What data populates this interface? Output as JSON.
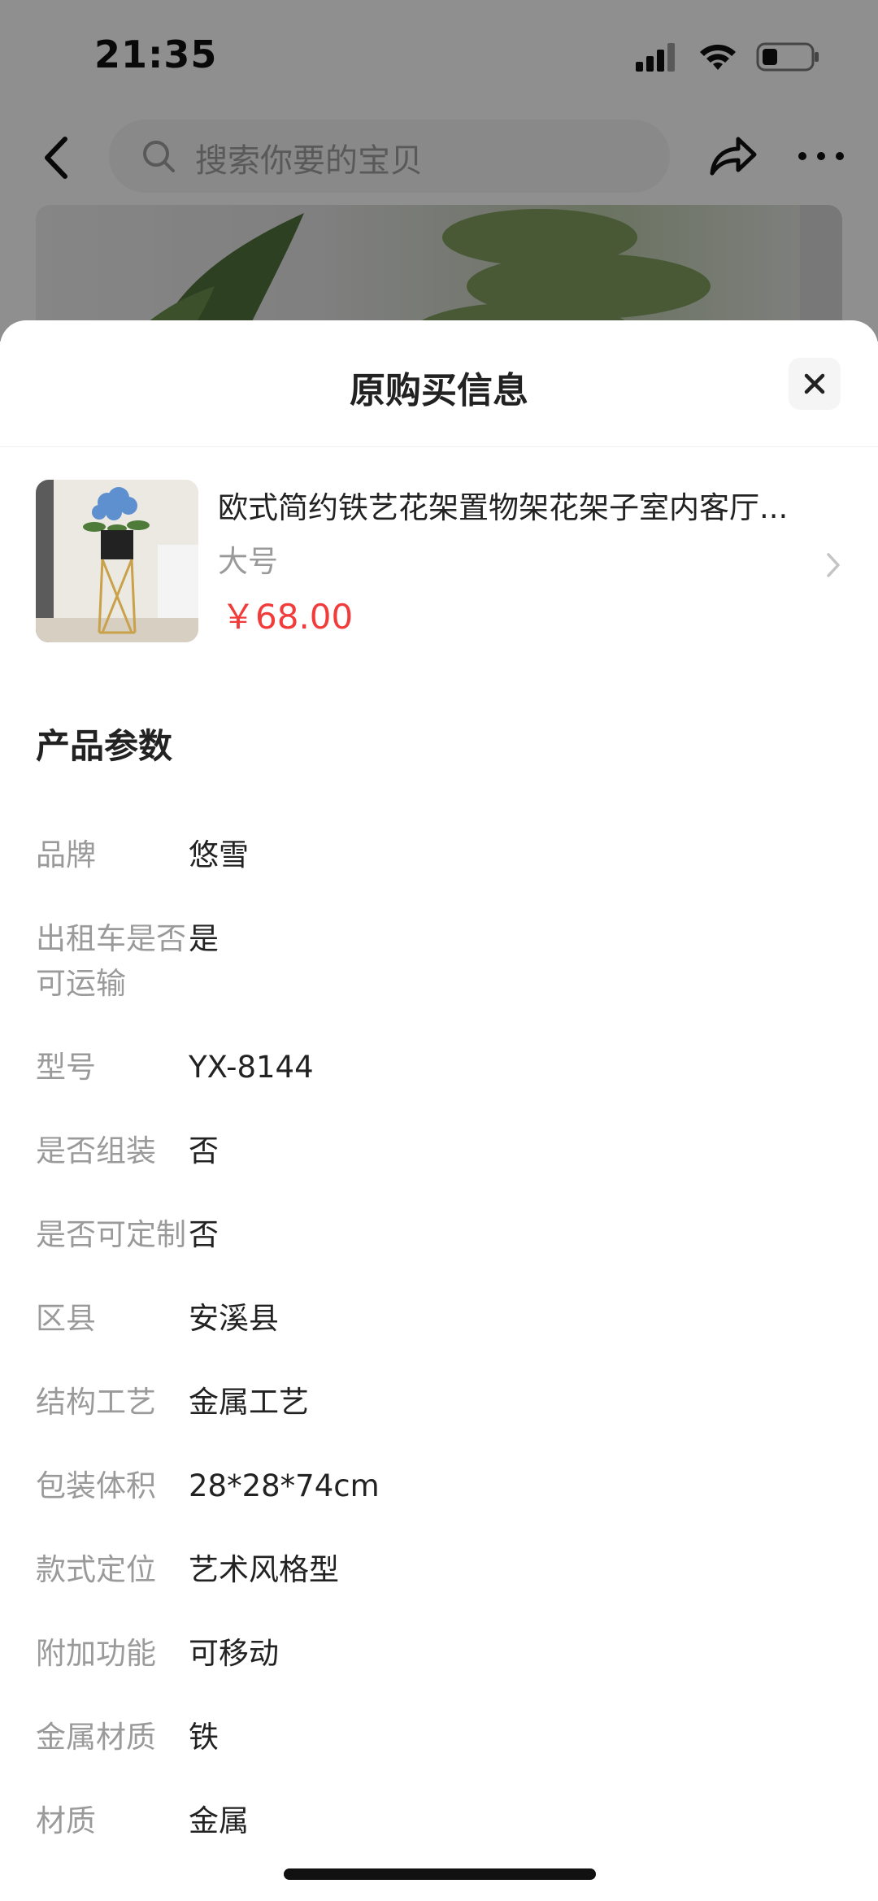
{
  "status_bar": {
    "time": "21:35"
  },
  "top_nav": {
    "search_placeholder": "搜索你要的宝贝"
  },
  "sheet": {
    "title": "原购买信息",
    "product": {
      "title": "欧式简约铁艺花架置物架花架子室内客厅...",
      "variant": "大号",
      "price": "￥68.00"
    },
    "section_title": "产品参数",
    "params": [
      {
        "label": "品牌",
        "value": "悠雪"
      },
      {
        "label": "出租车是否可运输",
        "value": "是"
      },
      {
        "label": "型号",
        "value": "YX-8144"
      },
      {
        "label": "是否组装",
        "value": "否"
      },
      {
        "label": "是否可定制",
        "value": "否"
      },
      {
        "label": "区县",
        "value": "安溪县"
      },
      {
        "label": "结构工艺",
        "value": "金属工艺"
      },
      {
        "label": "包装体积",
        "value": "28*28*74cm"
      },
      {
        "label": "款式定位",
        "value": "艺术风格型"
      },
      {
        "label": "附加功能",
        "value": "可移动"
      },
      {
        "label": "金属材质",
        "value": "铁"
      },
      {
        "label": "材质",
        "value": "金属"
      }
    ]
  },
  "colors": {
    "price": "#f23c3c",
    "label": "#9a9a9a",
    "text": "#222222"
  }
}
